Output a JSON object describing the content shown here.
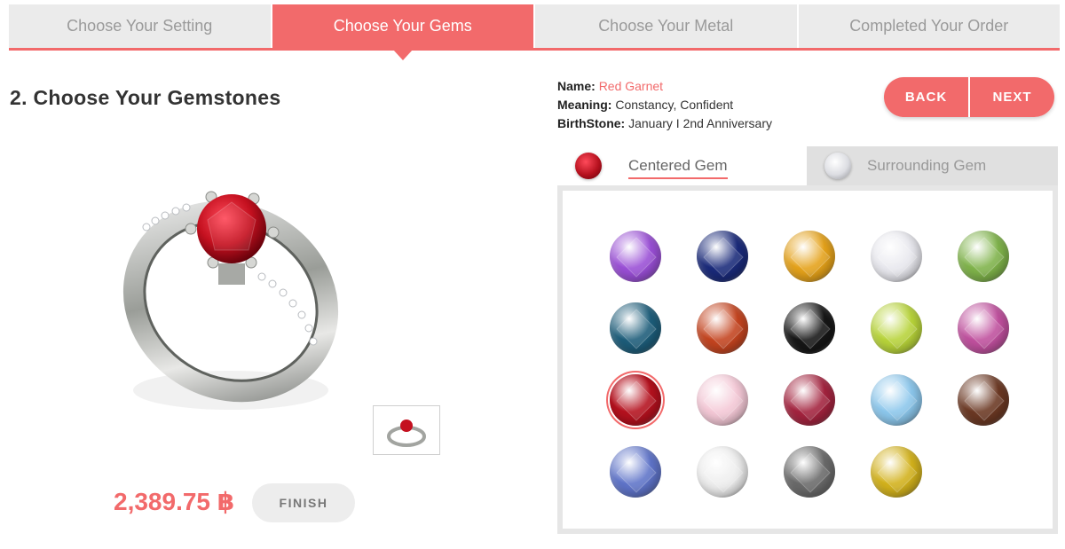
{
  "steps": [
    {
      "label": "Choose Your Setting",
      "active": false
    },
    {
      "label": "Choose Your Gems",
      "active": true
    },
    {
      "label": "Choose Your Metal",
      "active": false
    },
    {
      "label": "Completed Your Order",
      "active": false
    }
  ],
  "page_title": "2. Choose Your Gemstones",
  "info": {
    "name_key": "Name:",
    "name_value": "Red Garnet",
    "meaning_key": "Meaning:",
    "meaning_value": "Constancy, Confident",
    "birthstone_key": "BirthStone:",
    "birthstone_value": "January I 2nd Anniversary"
  },
  "buttons": {
    "back": "BACK",
    "next": "NEXT"
  },
  "tabs": {
    "centered": "Centered Gem",
    "surrounding": "Surrounding Gem"
  },
  "price": "2,389.75 ฿",
  "finish": "FINISH",
  "colors": {
    "accent": "#f26a6b"
  },
  "gems": [
    {
      "name": "amethyst",
      "color": "#9a4fd6"
    },
    {
      "name": "sapphire-blue",
      "color": "#1a2a7a"
    },
    {
      "name": "citrine",
      "color": "#e5a21a"
    },
    {
      "name": "diamond",
      "color": "#e8e8ee"
    },
    {
      "name": "peridot-green",
      "color": "#7fb34a"
    },
    {
      "name": "blue-topaz-dark",
      "color": "#1d5d7a"
    },
    {
      "name": "hessonite",
      "color": "#c4441f"
    },
    {
      "name": "onyx",
      "color": "#161616"
    },
    {
      "name": "peridot",
      "color": "#b8d43a"
    },
    {
      "name": "pink-tourmaline",
      "color": "#c0509e"
    },
    {
      "name": "red-garnet",
      "color": "#b5111e",
      "selected": true
    },
    {
      "name": "pink-quartz",
      "color": "#f4c8d6"
    },
    {
      "name": "rhodolite",
      "color": "#a3233e"
    },
    {
      "name": "aquamarine",
      "color": "#8cc7ec"
    },
    {
      "name": "smoky-quartz",
      "color": "#6b3823"
    },
    {
      "name": "tanzanite",
      "color": "#5f74c9"
    },
    {
      "name": "white-sapphire",
      "color": "#ededed"
    },
    {
      "name": "grey-diamond",
      "color": "#6a6a6a"
    },
    {
      "name": "yellow-sapphire",
      "color": "#d3b21c"
    }
  ]
}
